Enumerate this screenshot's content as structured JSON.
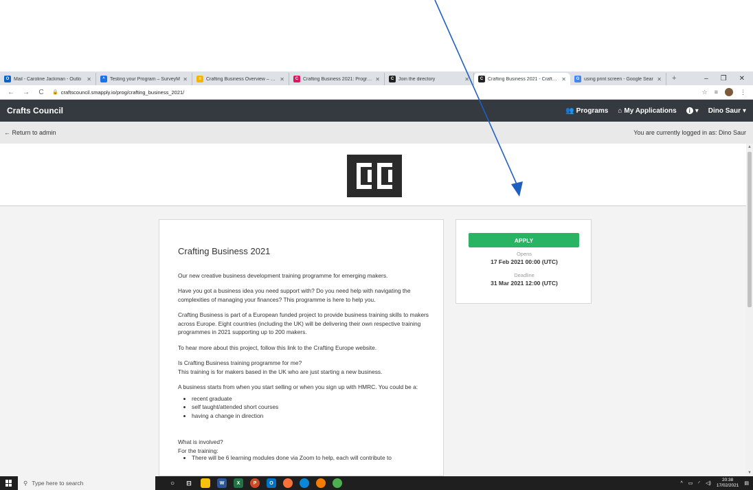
{
  "browser": {
    "tabs": [
      {
        "title": "Mail - Caroline Jackman - Outlo",
        "icon_color": "#0a64c8",
        "icon": "O",
        "width": 140
      },
      {
        "title": "Testing your Program – SurveyM",
        "icon_color": "#1a73e8",
        "icon": "^",
        "width": 140
      },
      {
        "title": "Crafting Business Overview – Cra",
        "icon_color": "#f4b400",
        "icon": "≡",
        "width": 141
      },
      {
        "title": "Crafting Business 2021: Program",
        "icon_color": "#d81b60",
        "icon": "C",
        "width": 139
      },
      {
        "title": "Join the directory",
        "icon_color": "#222222",
        "icon": "C",
        "width": 130
      },
      {
        "title": "Crafting Business 2021 - Crafts C",
        "icon_color": "#222222",
        "icon": "C",
        "width": 140,
        "active": true
      },
      {
        "title": "using print screen - Google Sear",
        "icon_color": "#4285f4",
        "icon": "G",
        "width": 140
      }
    ],
    "url": "craftscouncil.smapply.io/prog/crafting_business_2021/"
  },
  "navbar": {
    "brand": "Crafts Council",
    "programs": "Programs",
    "my_applications": "My Applications",
    "user": "Dino Saur"
  },
  "adminbar": {
    "return": "← Return to admin",
    "logged_in": "You are currently logged in as: Dino Saur"
  },
  "program": {
    "title": "Crafting Business 2021",
    "p1": "Our new creative business development training programme for emerging makers.",
    "p2": "Have you got a business idea you need support with? Do you need help with navigating the complexities of managing your finances? This programme is here to help you.",
    "p3": "Crafting Business is part of a European funded project to provide business training skills to makers across Europe. Eight countries (including the UK) will be delivering their own respective training programmes in 2021 supporting up to 200 makers.",
    "p4": "To hear more about this project, follow this link to the Crafting Europe website.",
    "p5a": "Is Crafting Business training programme for me?",
    "p5b": "This training is for makers based in the UK who are just starting a new business.",
    "p6": "A business starts from when you start selling or when you sign up with HMRC. You could be a:",
    "bullets": [
      "recent graduate",
      "self taught/attended short courses",
      "having a change in direction"
    ],
    "p7a": "What is involved?",
    "p7b": "For the training:",
    "p7c": "There will be 6 learning modules done via Zoom to help, each will contribute to"
  },
  "apply": {
    "button": "APPLY",
    "opens_label": "Opens",
    "opens_value": "17 Feb 2021 00:00 (UTC)",
    "deadline_label": "Deadline",
    "deadline_value": "31 Mar 2021 12:00 (UTC)"
  },
  "taskbar": {
    "search_placeholder": "Type here to search",
    "time": "20:38",
    "date": "17/02/2021"
  },
  "colors": {
    "navbar": "#343a40",
    "apply": "#28b463",
    "arrow": "#1f5fbf"
  }
}
